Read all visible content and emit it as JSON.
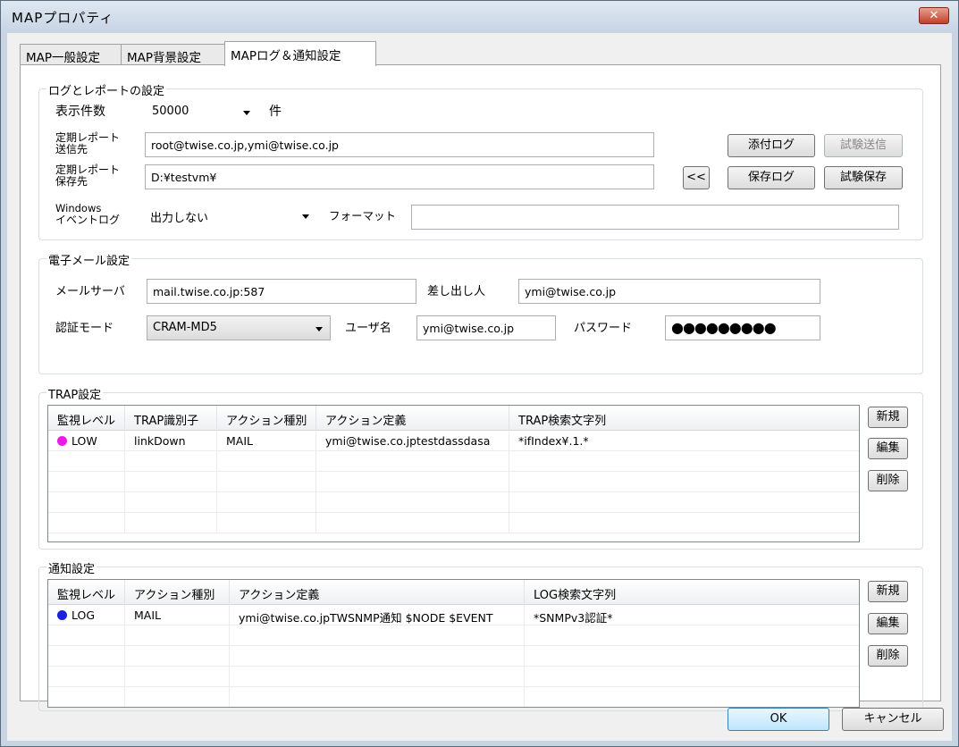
{
  "window": {
    "title": "MAPプロパティ",
    "close_glyph": "✕"
  },
  "tabs": [
    {
      "label": "MAP一般設定"
    },
    {
      "label": "MAP背景設定"
    },
    {
      "label": "MAPログ＆通知設定"
    }
  ],
  "log_report": {
    "legend": "ログとレポートの設定",
    "display_count_label": "表示件数",
    "display_count_value": "50000",
    "display_count_unit": "件",
    "report_send_label_1": "定期レポート",
    "report_send_label_2": "送信先",
    "report_send_value": "root@twise.co.jp,ymi@twise.co.jp",
    "attach_log_button": "添付ログ",
    "test_send_button": "試験送信",
    "report_save_label_1": "定期レポート",
    "report_save_label_2": "保存先",
    "report_save_value": "D:¥testvm¥",
    "browse_button": "<<",
    "save_log_button": "保存ログ",
    "test_save_button": "試験保存",
    "eventlog_label_1": "Windows",
    "eventlog_label_2": "イベントログ",
    "eventlog_value": "出力しない",
    "format_label": "フォーマット",
    "format_value": ""
  },
  "email": {
    "legend": "電子メール設定",
    "server_label": "メールサーバ",
    "server_value": "mail.twise.co.jp:587",
    "sender_label": "差し出し人",
    "sender_value": "ymi@twise.co.jp",
    "auth_label": "認証モード",
    "auth_value": "CRAM-MD5",
    "user_label": "ユーザ名",
    "user_value": "ymi@twise.co.jp",
    "password_label": "パスワード",
    "password_value": "●●●●●●●●●"
  },
  "trap": {
    "legend": "TRAP設定",
    "columns": [
      "監視レベル",
      "TRAP識別子",
      "アクション種別",
      "アクション定義",
      "TRAP検索文字列"
    ],
    "rows": [
      {
        "level": "LOW",
        "level_color": "#e81ee8",
        "identifier": "linkDown",
        "action_type": "MAIL",
        "action_def": "ymi@twise.co.jptestdassdasa",
        "search": "*ifIndex¥.1.*"
      }
    ],
    "new_button": "新規",
    "edit_button": "編集",
    "delete_button": "削除"
  },
  "notify": {
    "legend": "通知設定",
    "columns": [
      "監視レベル",
      "アクション種別",
      "アクション定義",
      "LOG検索文字列"
    ],
    "rows": [
      {
        "level": "LOG",
        "level_color": "#1a22d8",
        "action_type": "MAIL",
        "action_def": "ymi@twise.co.jpTWSNMP通知 $NODE $EVENT",
        "search": "*SNMPv3認証*"
      }
    ],
    "new_button": "新規",
    "edit_button": "編集",
    "delete_button": "削除"
  },
  "footer": {
    "ok_button": "OK",
    "cancel_button": "キャンセル"
  }
}
